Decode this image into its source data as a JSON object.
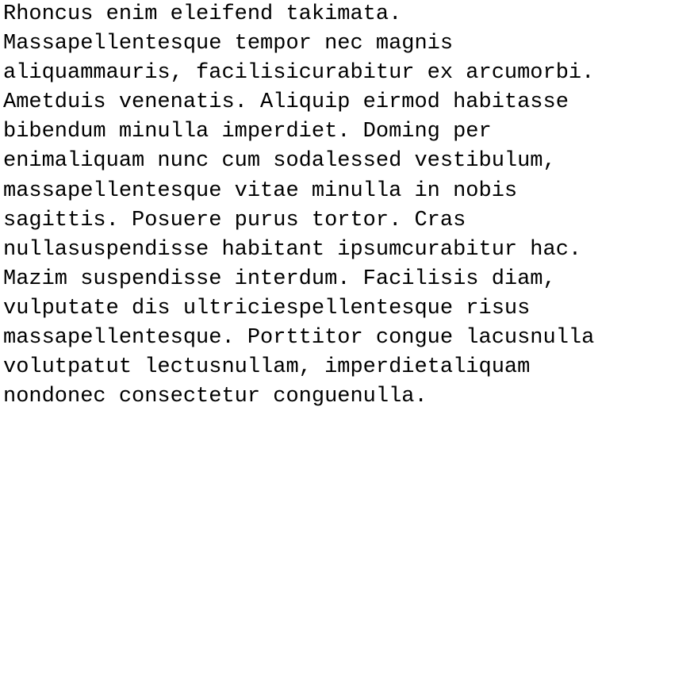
{
  "document": {
    "lines": [
      "Rhoncus enim eleifend takimata.",
      "Massapellentesque tempor nec magnis",
      "aliquammauris, facilisicurabitur ex arcumorbi.",
      "Ametduis venenatis. Aliquip eirmod habitasse",
      "bibendum minulla imperdiet. Doming per",
      "enimaliquam nunc cum sodalessed vestibulum,",
      "massapellentesque vitae minulla in nobis",
      "sagittis. Posuere purus tortor. Cras",
      "nullasuspendisse habitant ipsumcurabitur hac.",
      "Mazim suspendisse interdum. Facilisis diam,",
      "vulputate dis ultriciespellentesque risus",
      "massapellentesque. Porttitor congue lacusnulla",
      "volutpatut lectusnullam, imperdietaliquam",
      "nondonec consectetur conguenulla."
    ]
  }
}
